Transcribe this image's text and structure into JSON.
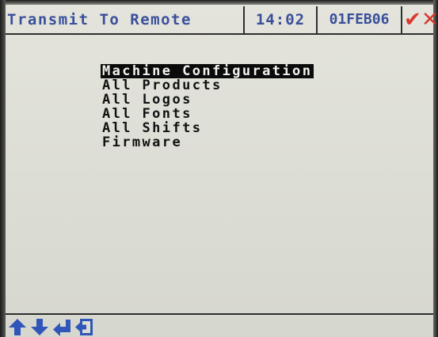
{
  "header": {
    "title": "Transmit To Remote",
    "time": "14:02",
    "date": "01FEB06",
    "confirm_icon": "check-icon",
    "cancel_icon": "cross-icon",
    "accent_color": "#3a4f9b",
    "status_color": "#d83a2c"
  },
  "menu": {
    "selected_index": 0,
    "items": [
      "Machine Configuration",
      "All Products",
      "All Logos",
      "All Fonts",
      "All Shifts",
      "Firmware"
    ]
  },
  "footer": {
    "keys": [
      "arrow-up-icon",
      "arrow-down-icon",
      "enter-icon",
      "back-icon"
    ]
  }
}
